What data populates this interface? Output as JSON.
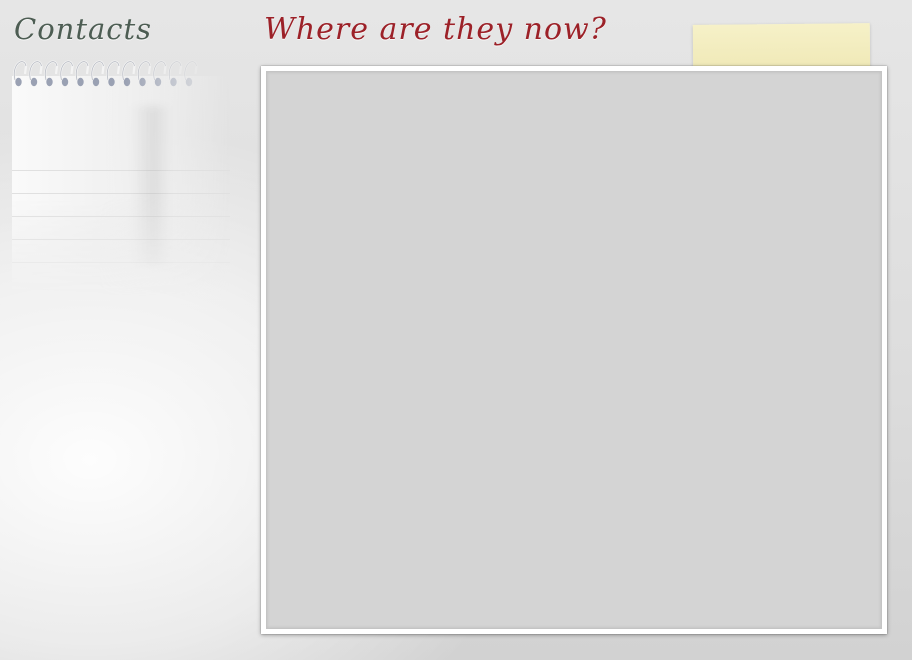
{
  "sidebar": {
    "title": "Contacts",
    "notepad": {
      "spiral_icon": "spiral-binding-icon"
    }
  },
  "main": {
    "title": "Where are they now?",
    "note": {
      "text": ""
    },
    "photo": {
      "caption": ""
    }
  },
  "colors": {
    "sidebar_title": "#4d5d53",
    "main_title": "#9c2128",
    "sticky_note": "#f2ecbd",
    "photo_area": "#d4d4d4",
    "frame": "#ffffff"
  }
}
